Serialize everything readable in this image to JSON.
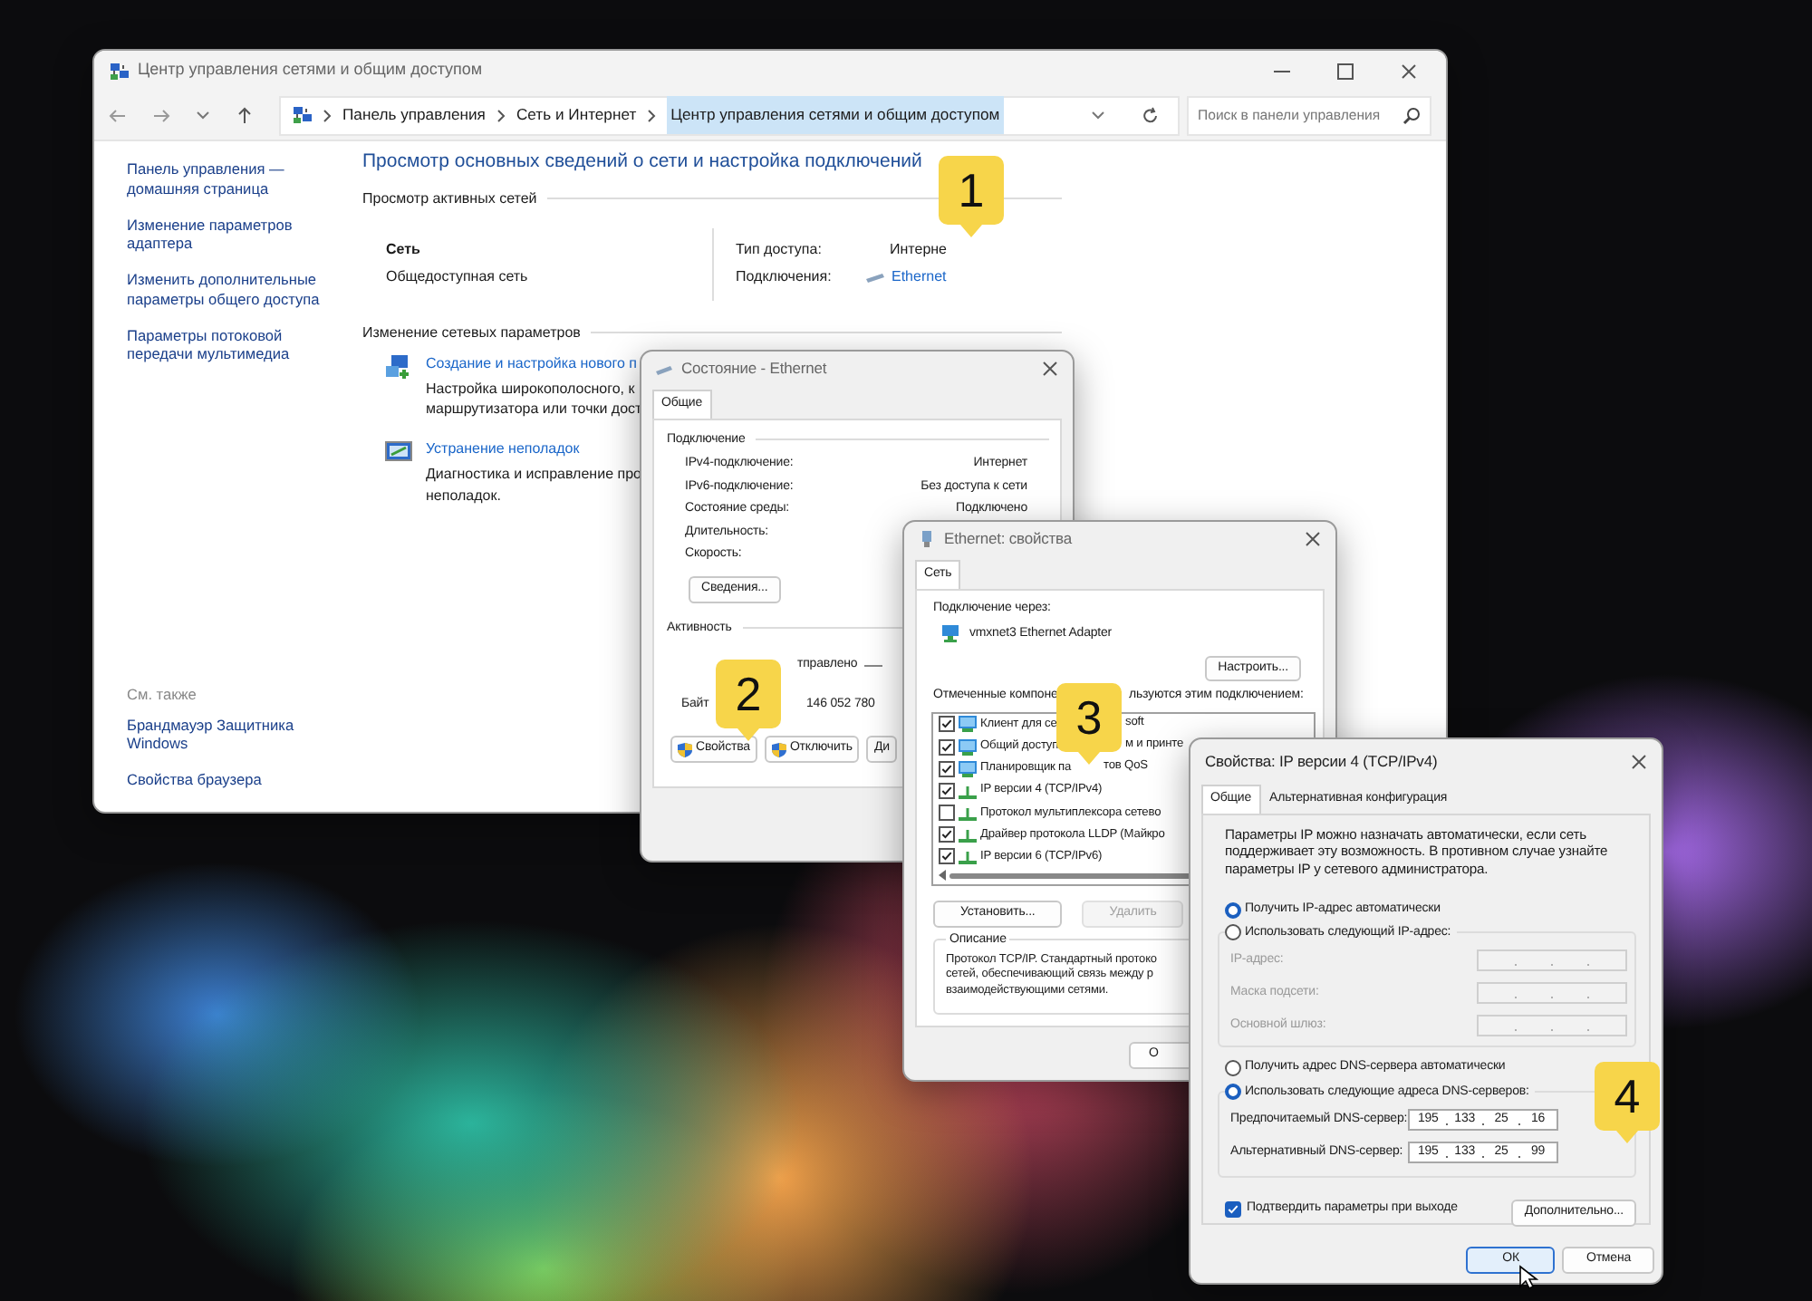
{
  "main_window": {
    "title": "Центр управления сетями и общим доступом",
    "breadcrumbs": [
      "Панель управления",
      "Сеть и Интернет",
      "Центр управления сетями и общим доступом"
    ],
    "search": {
      "placeholder": "Поиск в панели управления"
    },
    "sidebar": {
      "links": [
        "Панель управления — домашняя страница",
        "Изменение параметров адаптера",
        "Изменить дополнительные параметры общего доступа",
        "Параметры потоковой передачи мультимедиа"
      ],
      "see_also_title": "См. также",
      "see_also_links": [
        "Брандмауэр Защитника Windows",
        "Свойства браузера"
      ]
    },
    "heading": "Просмотр основных сведений о сети и настройка подключений",
    "active_networks": {
      "title": "Просмотр активных сетей",
      "network_name": "Сеть",
      "network_type": "Общедоступная сеть",
      "access_label": "Тип доступа:",
      "access_value": "Интерне",
      "connections_label": "Подключения:",
      "connections_value": "Ethernet"
    },
    "change_settings": {
      "title": "Изменение сетевых параметров",
      "tasks": [
        {
          "kind": "create",
          "title": "Создание и настройка нового п",
          "description": [
            "Настройка широкополосного, к",
            "маршрутизатора или точки дост"
          ]
        },
        {
          "kind": "troubleshoot",
          "title": "Устранение неполадок",
          "description": [
            "Диагностика и исправление про",
            "неполадок."
          ]
        }
      ]
    }
  },
  "status_dialog": {
    "title": "Состояние - Ethernet",
    "tabs": [
      {
        "label": "Общие",
        "selected": true
      }
    ],
    "connection": {
      "title": "Подключение",
      "rows": [
        {
          "label": "IPv4-подключение:",
          "value": "Интернет"
        },
        {
          "label": "IPv6-подключение:",
          "value": "Без доступа к сети"
        },
        {
          "label": "Состояние среды:",
          "value": "Подключено"
        },
        {
          "label": "Длительность:"
        },
        {
          "label": "Скорость:"
        }
      ]
    },
    "details_button": "Сведения...",
    "activity": {
      "title": "Активность",
      "sent_label": "тправлено",
      "bytes_label": "Байт",
      "bytes_value": "146 052 780"
    },
    "buttons": [
      {
        "label": "Свойства",
        "shield": true
      },
      {
        "label": "Отключить",
        "shield": true
      },
      {
        "label": "Ди",
        "shield": false
      }
    ]
  },
  "ethernet_dialog": {
    "title": "Ethernet: свойства",
    "tabs": [
      {
        "label": "Сеть",
        "selected": true
      }
    ],
    "connect_using_label": "Подключение через:",
    "adapter": "vmxnet3 Ethernet Adapter",
    "configure_button": "Настроить...",
    "components_label": "Отмеченные компоне",
    "components_label_tail": "льзуются этим подключением:",
    "components": [
      {
        "kind": "client",
        "checked": true,
        "label": "Клиент для се",
        "tail": "soft"
      },
      {
        "kind": "client",
        "checked": true,
        "label": "Общий доступ",
        "tail": "м и принте"
      },
      {
        "kind": "client",
        "checked": true,
        "label": "Планировщик па",
        "tail": "тов QoS"
      },
      {
        "kind": "protocol",
        "checked": true,
        "label": "IP версии 4 (TCP/IPv4)"
      },
      {
        "kind": "protocol",
        "checked": false,
        "label": "Протокол мультиплексора сетево"
      },
      {
        "kind": "protocol",
        "checked": true,
        "label": "Драйвер протокола LLDP (Майкро"
      },
      {
        "kind": "protocol",
        "checked": true,
        "label": "IP версии 6 (TCP/IPv6)"
      }
    ],
    "buttons": [
      {
        "label": "Установить...",
        "disabled": false
      },
      {
        "label": "Удалить",
        "disabled": true
      }
    ],
    "description_title": "Описание",
    "description": [
      "Протокол TCP/IP. Стандартный протоко",
      "сетей, обеспечивающий связь между р",
      "взаимодействующими сетями."
    ],
    "bottom_button": "О"
  },
  "ipv4_dialog": {
    "title": "Свойства: IP версии 4 (TCP/IPv4)",
    "tabs": [
      {
        "label": "Общие",
        "selected": true
      },
      {
        "label": "Альтернативная конфигурация",
        "selected": false
      }
    ],
    "intro": "Параметры IP можно назначать автоматически, если сеть поддерживает эту возможность. В противном случае узнайте параметры IP у сетевого администратора.",
    "ip_options": [
      {
        "label": "Получить IP-адрес автоматически",
        "selected": true
      },
      {
        "label": "Использовать следующий IP-адрес:",
        "selected": false
      }
    ],
    "ip_fields": [
      {
        "label": "IP-адрес:",
        "disabled": true
      },
      {
        "label": "Маска подсети:",
        "disabled": true
      },
      {
        "label": "Основной шлюз:",
        "disabled": true
      }
    ],
    "dns_options": [
      {
        "label": "Получить адрес DNS-сервера автоматически",
        "selected": false
      },
      {
        "label": "Использовать следующие адреса DNS-серверов:",
        "selected": true
      }
    ],
    "dns_fields": [
      {
        "label": "Предпочитаемый DNS-сервер:",
        "disabled": false,
        "octets": [
          "195",
          "133",
          "25",
          "16"
        ]
      },
      {
        "label": "Альтернативный DNS-сервер:",
        "disabled": false,
        "octets": [
          "195",
          "133",
          "25",
          "99"
        ]
      }
    ],
    "validate": {
      "label": "Подтвердить параметры при выходе",
      "checked": true
    },
    "advanced_button": "Дополнительно...",
    "ok_button": "ОК",
    "cancel_button": "Отмена"
  },
  "callouts": [
    "1",
    "2",
    "3",
    "4"
  ]
}
